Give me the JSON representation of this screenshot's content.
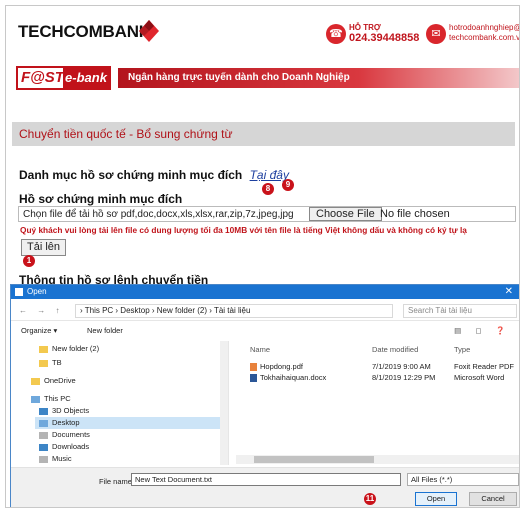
{
  "brand": {
    "name": "TECHCOMBANK",
    "hotline_label": "HỖ TRỢ",
    "hotline": "024.39448858",
    "email_line1": "hotrodoanhnghiep@",
    "email_line2": "techcombank.com.vn"
  },
  "banner": {
    "logo_left": "F@ST",
    "logo_right": "e-bank",
    "tagline": "Ngân hàng trực tuyến dành cho Doanh Nghiệp"
  },
  "page": {
    "section_title": "Chuyển tiền quốc tế - Bổ sung chứng từ",
    "doc_list_label": "Danh mục hồ sơ chứng minh mục đích",
    "doc_list_link": "Tại đây",
    "req_label": "Hồ sơ chứng minh mục đích",
    "file_hint": "Chọn file để tải hồ sơ   pdf,doc,docx,xls,xlsx,rar,zip,7z,jpeg,jpg",
    "choose_file": "Choose File",
    "no_file": "No file chosen",
    "warning": "Quý khách vui lòng tải lên file có dung lượng tối đa 10MB với tên file là tiếng Việt không dấu và không có ký tự lạ",
    "upload": "Tải lên",
    "info_title": "Thông tin hồ sơ lệnh chuyển tiền",
    "badges": {
      "b8": "8",
      "b9": "9",
      "b1": "1",
      "b11": "11"
    }
  },
  "dialog": {
    "title": "Open",
    "path": "›  This PC  ›  Desktop  ›  New folder (2)  ›  Tài tài liệu",
    "search_placeholder": "Search Tài tài liệu",
    "organize": "Organize ▾",
    "new_folder": "New folder",
    "nav": [
      "New folder (2)",
      "TB",
      "OneDrive",
      "This PC",
      "3D Objects",
      "Desktop",
      "Documents",
      "Downloads",
      "Music"
    ],
    "columns": {
      "name": "Name",
      "date": "Date modified",
      "type": "Type"
    },
    "files": [
      {
        "name": "Hopdong.pdf",
        "date": "7/1/2019 9:00 AM",
        "type": "Foxit Reader PDF"
      },
      {
        "name": "Tokhaihaiquan.docx",
        "date": "8/1/2019 12:29 PM",
        "type": "Microsoft Word"
      }
    ],
    "file_name_label": "File name:",
    "file_name_value": "New Text Document.txt",
    "file_type": "All Files (*.*)",
    "open": "Open",
    "cancel": "Cancel"
  }
}
